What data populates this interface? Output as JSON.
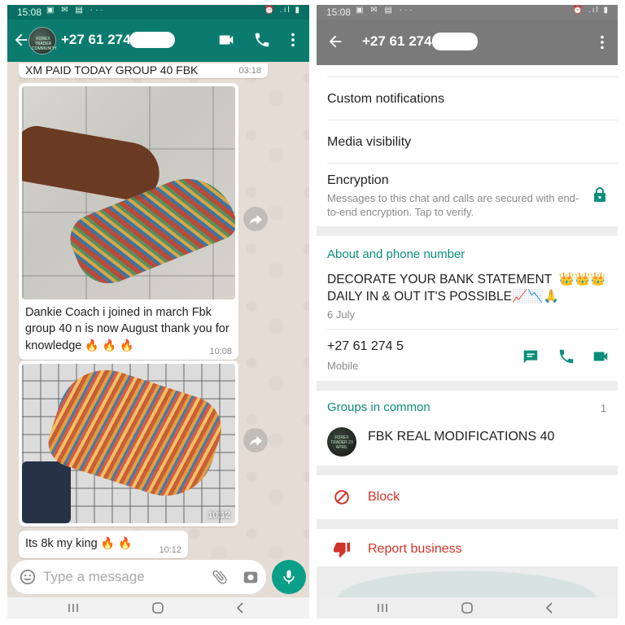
{
  "status_bar": {
    "left_time": "15:08",
    "right_time": "15:08"
  },
  "chat": {
    "contact_name": "+27 61 274",
    "avatar_text": "FOREX TRADER COMMUNITY",
    "messages": [
      {
        "text": "XM PAID TODAY GROUP 40 FBK",
        "time": "03:18"
      },
      {
        "caption": "Dankie Coach i joined in march Fbk group 40 n is now August thank you for knowledge",
        "emoji": "🔥 🔥 🔥",
        "time": "10:08"
      },
      {
        "time": "10:12"
      },
      {
        "text": "Its 8k my king",
        "emoji": "🔥 🔥",
        "time": "10:12"
      }
    ],
    "input_placeholder": "Type a message"
  },
  "contact_info": {
    "title": "+27 61 274",
    "rows": {
      "custom_notifications": "Custom notifications",
      "media_visibility": "Media visibility",
      "encryption": "Encryption",
      "encryption_sub": "Messages to this chat and calls are secured with end-to-end encryption. Tap to verify."
    },
    "about": {
      "section_title": "About and phone number",
      "line1": "DECORATE YOUR BANK STATEMENT",
      "line1_emoji": "👑👑👑",
      "line2": "DAILY IN & OUT IT'S POSSIBLE",
      "line2_emoji": "📈📉🙏",
      "date": "6 July",
      "phone": "+27 61 274 5",
      "phone_type": "Mobile"
    },
    "groups": {
      "section_title": "Groups in common",
      "count": "1",
      "group_name": "FBK REAL MODIFICATIONS 40",
      "group_avatar_text": "FOREX TRADER 23 APRIL"
    },
    "block_label": "Block",
    "report_label": "Report business"
  },
  "colors": {
    "teal_dark": "#0b7b6f",
    "accent_green": "#0b8e7a",
    "danger_red": "#d0342c"
  }
}
